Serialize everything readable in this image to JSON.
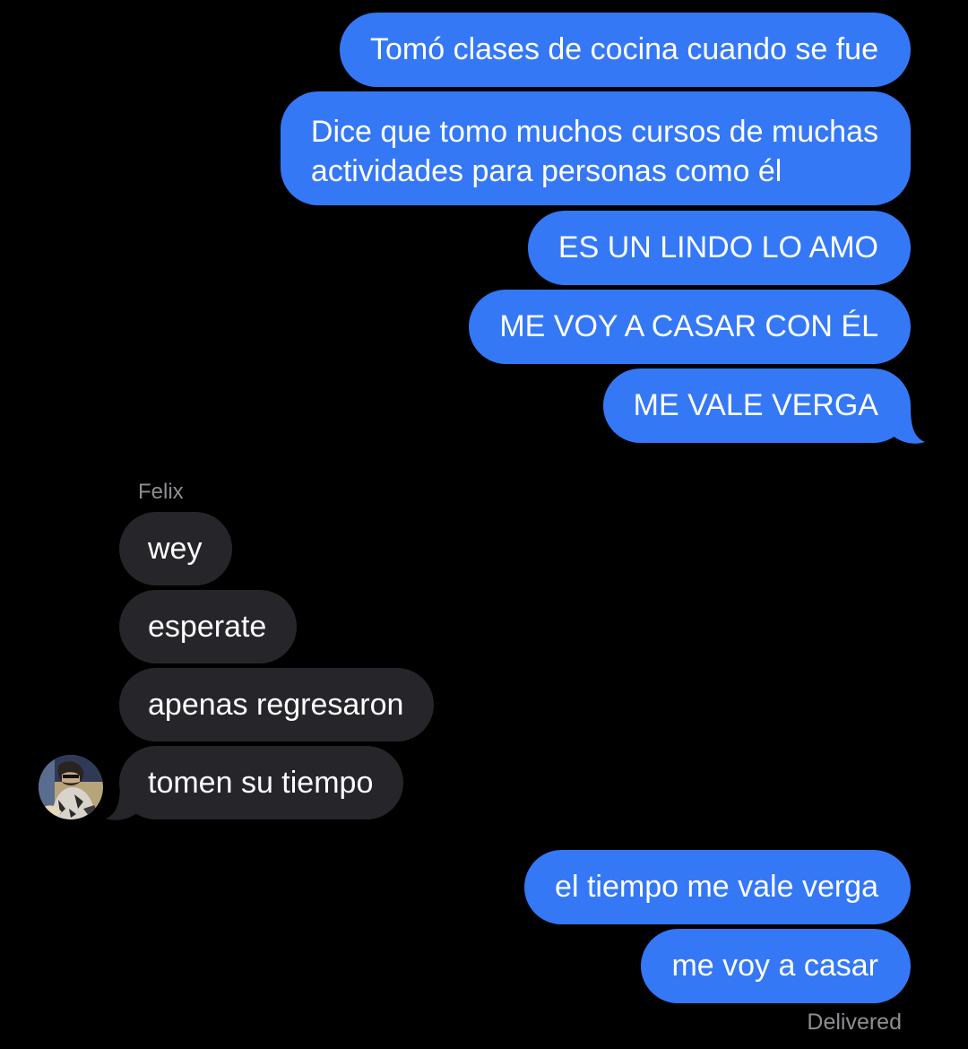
{
  "outgoing_group_1": [
    {
      "text": "Tomó clases de cocina cuando se fue"
    },
    {
      "text": "Dice que tomo muchos cursos de muchas\nactividades para personas como él"
    },
    {
      "text": "ES UN LINDO LO AMO"
    },
    {
      "text": "ME VOY A CASAR CON ÉL"
    },
    {
      "text": "ME VALE VERGA"
    }
  ],
  "incoming": {
    "sender": "Felix",
    "messages": [
      {
        "text": "wey"
      },
      {
        "text": "esperate"
      },
      {
        "text": "apenas regresaron"
      },
      {
        "text": "tomen su tiempo"
      }
    ]
  },
  "outgoing_group_2": [
    {
      "text": "el tiempo me vale verga"
    },
    {
      "text": "me voy a casar"
    }
  ],
  "status": "Delivered",
  "colors": {
    "background": "#000000",
    "outgoing_bubble": "#3478f6",
    "incoming_bubble": "#26252a",
    "secondary_text": "#8e8e93"
  }
}
